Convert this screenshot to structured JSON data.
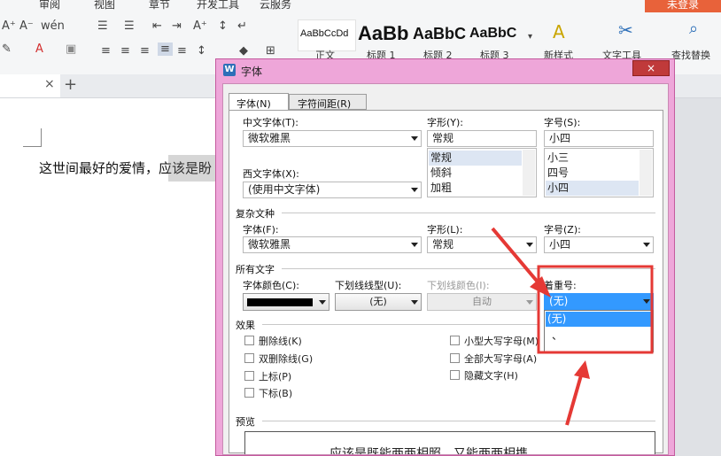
{
  "ribbon": {
    "menu_tabs": [
      "审阅",
      "视图",
      "章节",
      "开发工具",
      "云服务"
    ],
    "login": "未登录",
    "style_samples": [
      "AaBbCcDd",
      "AaBb",
      "AaBbC",
      "AaBbC"
    ],
    "style_labels": [
      "正文",
      "标题 1",
      "标题 2",
      "标题 3"
    ],
    "new_style": "新样式",
    "text_tools": "文字工具",
    "find_replace": "查找替换"
  },
  "tabs": {
    "close": "×",
    "add": "+"
  },
  "document": {
    "text": "这世间最好的爱情，应该是盼"
  },
  "dialog": {
    "title": "字体",
    "tab_font": "字体(N)",
    "tab_spacing": "字符间距(R)",
    "cn_font_label": "中文字体(T):",
    "cn_font_value": "微软雅黑",
    "style_label": "字形(Y):",
    "style_value": "常规",
    "style_list": [
      "常规",
      "倾斜",
      "加粗"
    ],
    "size_label": "字号(S):",
    "size_value": "小四",
    "size_list": [
      "小三",
      "四号",
      "小四"
    ],
    "west_font_label": "西文字体(X):",
    "west_font_value": "(使用中文字体)",
    "complex_section": "复杂文种",
    "cx_font_label": "字体(F):",
    "cx_font_value": "微软雅黑",
    "cx_style_label": "字形(L):",
    "cx_style_value": "常规",
    "cx_size_label": "字号(Z):",
    "cx_size_value": "小四",
    "all_text_section": "所有文字",
    "color_label": "字体颜色(C):",
    "underline_type_label": "下划线线型(U):",
    "underline_type_value": "(无)",
    "underline_color_label": "下划线颜色(I):",
    "underline_color_value": "自动",
    "emphasis_label": "着重号:",
    "emphasis_value": "(无)",
    "emphasis_options": [
      "(无)",
      "、"
    ],
    "effects_section": "效果",
    "effects_left": [
      "删除线(K)",
      "双删除线(G)",
      "上标(P)",
      "下标(B)"
    ],
    "effects_right": [
      "小型大写字母(M)",
      "全部大写字母(A)",
      "隐藏文字(H)"
    ],
    "preview_section": "预览",
    "preview_text": "应该是既能两两相照，又能两两相携"
  },
  "colors": {
    "highlight": "#e53935",
    "dialog_frame": "#eea6d9",
    "selection": "#3399ff"
  }
}
